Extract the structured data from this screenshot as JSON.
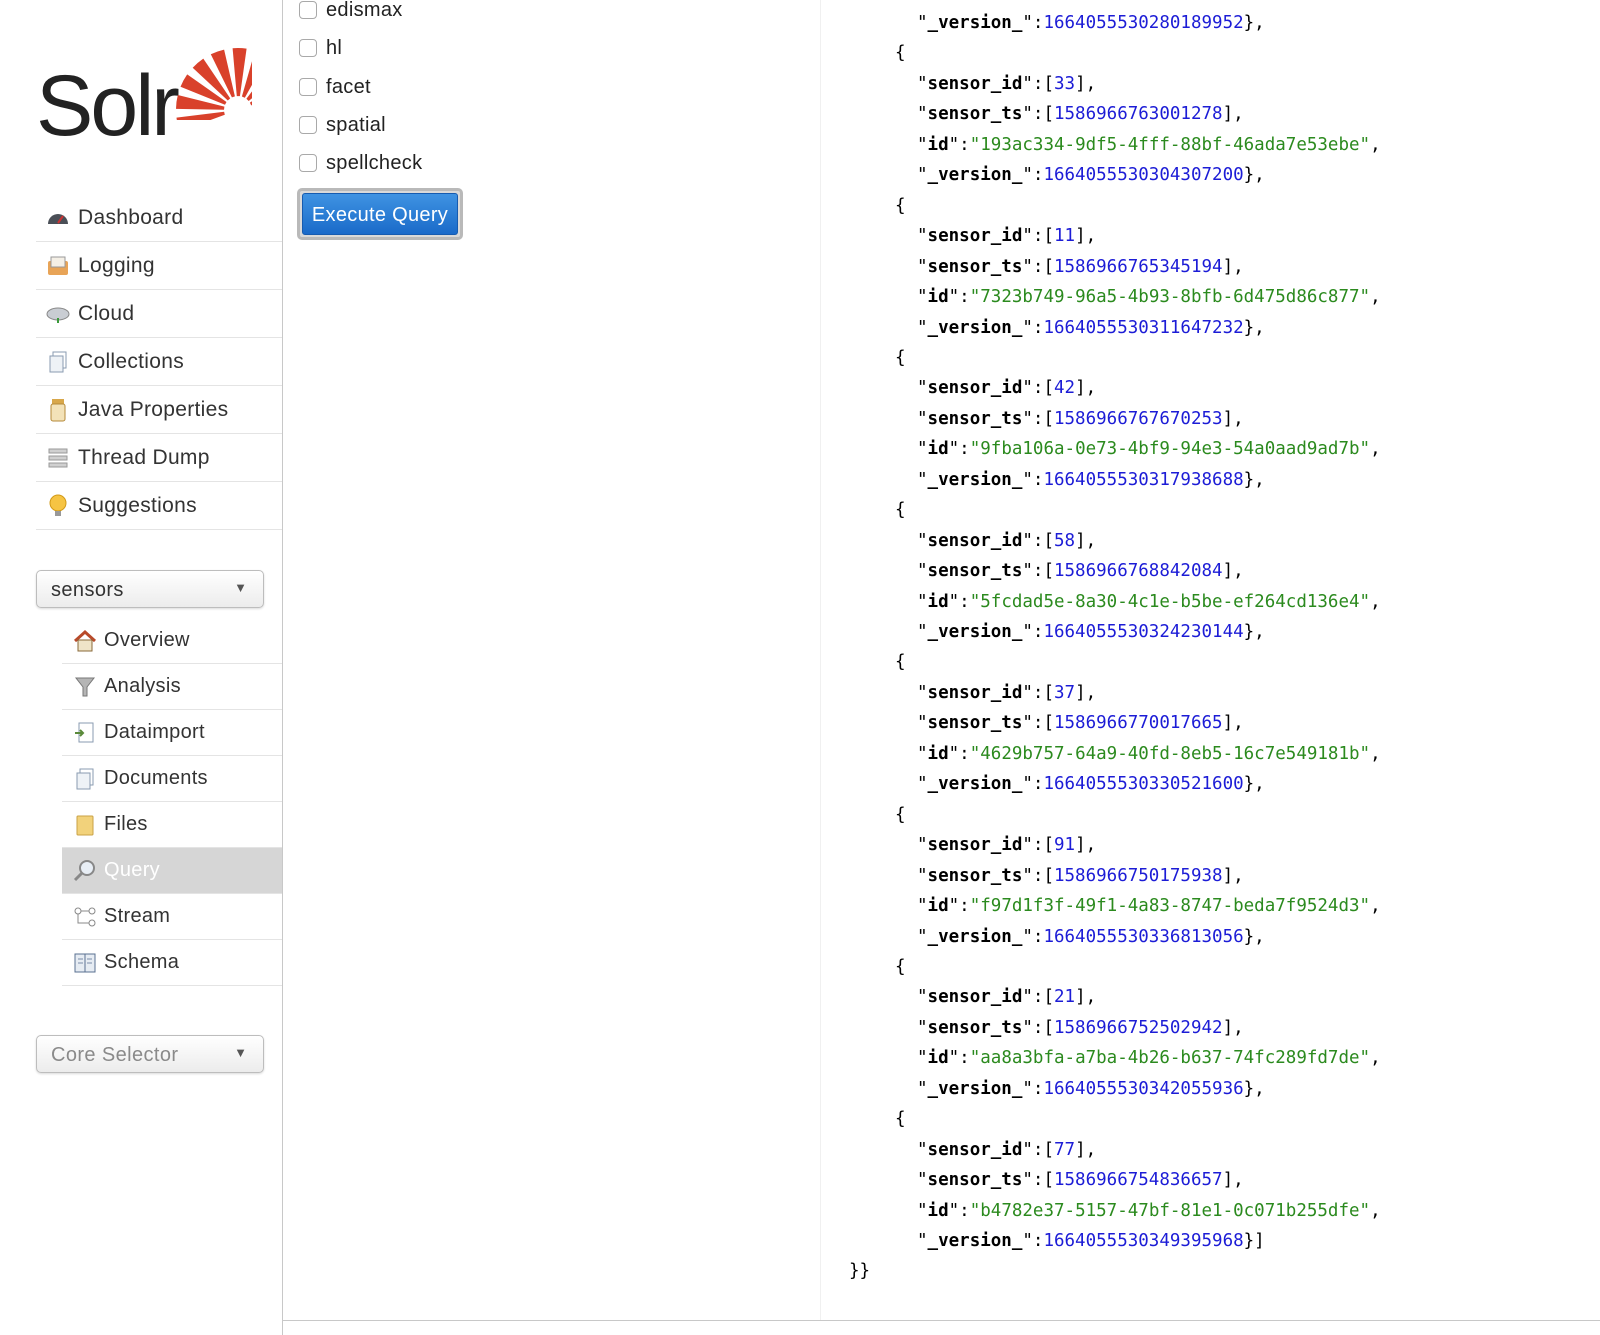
{
  "logo": {
    "text": "Solr"
  },
  "nav": [
    {
      "label": "Dashboard",
      "icon": "dashboard-icon"
    },
    {
      "label": "Logging",
      "icon": "logging-icon"
    },
    {
      "label": "Cloud",
      "icon": "cloud-icon"
    },
    {
      "label": "Collections",
      "icon": "collections-icon"
    },
    {
      "label": "Java Properties",
      "icon": "java-properties-icon"
    },
    {
      "label": "Thread Dump",
      "icon": "thread-dump-icon"
    },
    {
      "label": "Suggestions",
      "icon": "suggestions-icon"
    }
  ],
  "core_select": {
    "value": "sensors"
  },
  "core_nav": [
    {
      "label": "Overview",
      "icon": "home-icon"
    },
    {
      "label": "Analysis",
      "icon": "funnel-icon"
    },
    {
      "label": "Dataimport",
      "icon": "dataimport-icon"
    },
    {
      "label": "Documents",
      "icon": "documents-icon"
    },
    {
      "label": "Files",
      "icon": "folder-icon"
    },
    {
      "label": "Query",
      "icon": "magnifier-icon",
      "active": true
    },
    {
      "label": "Stream",
      "icon": "stream-icon"
    },
    {
      "label": "Schema",
      "icon": "schema-icon"
    }
  ],
  "core_selector": {
    "placeholder": "Core Selector"
  },
  "query_form": {
    "options": [
      {
        "label": "edismax",
        "checked": false
      },
      {
        "label": "hl",
        "checked": false
      },
      {
        "label": "facet",
        "checked": false
      },
      {
        "label": "spatial",
        "checked": false
      },
      {
        "label": "spellcheck",
        "checked": false
      }
    ],
    "execute_label": "Execute Query"
  },
  "response": {
    "first_version": "1664055530280189952",
    "docs": [
      {
        "sensor_id": "33",
        "sensor_ts": "1586966763001278",
        "id": "193ac334-9df5-4fff-88bf-46ada7e53ebe",
        "version": "1664055530304307200"
      },
      {
        "sensor_id": "11",
        "sensor_ts": "1586966765345194",
        "id": "7323b749-96a5-4b93-8bfb-6d475d86c877",
        "version": "1664055530311647232"
      },
      {
        "sensor_id": "42",
        "sensor_ts": "1586966767670253",
        "id": "9fba106a-0e73-4bf9-94e3-54a0aad9ad7b",
        "version": "1664055530317938688"
      },
      {
        "sensor_id": "58",
        "sensor_ts": "1586966768842084",
        "id": "5fcdad5e-8a30-4c1e-b5be-ef264cd136e4",
        "version": "1664055530324230144"
      },
      {
        "sensor_id": "37",
        "sensor_ts": "1586966770017665",
        "id": "4629b757-64a9-40fd-8eb5-16c7e549181b",
        "version": "1664055530330521600"
      },
      {
        "sensor_id": "91",
        "sensor_ts": "1586966750175938",
        "id": "f97d1f3f-49f1-4a83-8747-beda7f9524d3",
        "version": "1664055530336813056"
      },
      {
        "sensor_id": "21",
        "sensor_ts": "1586966752502942",
        "id": "aa8a3bfa-a7ba-4b26-b637-74fc289fd7de",
        "version": "1664055530342055936"
      },
      {
        "sensor_id": "77",
        "sensor_ts": "1586966754836657",
        "id": "b4782e37-5157-47bf-81e1-0c071b255dfe",
        "version": "1664055530349395968"
      }
    ]
  },
  "colors": {
    "accent": "#1a6ac9",
    "json_number": "#1c1cd6",
    "json_string": "#2b8a1e",
    "logo_sun": "#d9412b"
  }
}
